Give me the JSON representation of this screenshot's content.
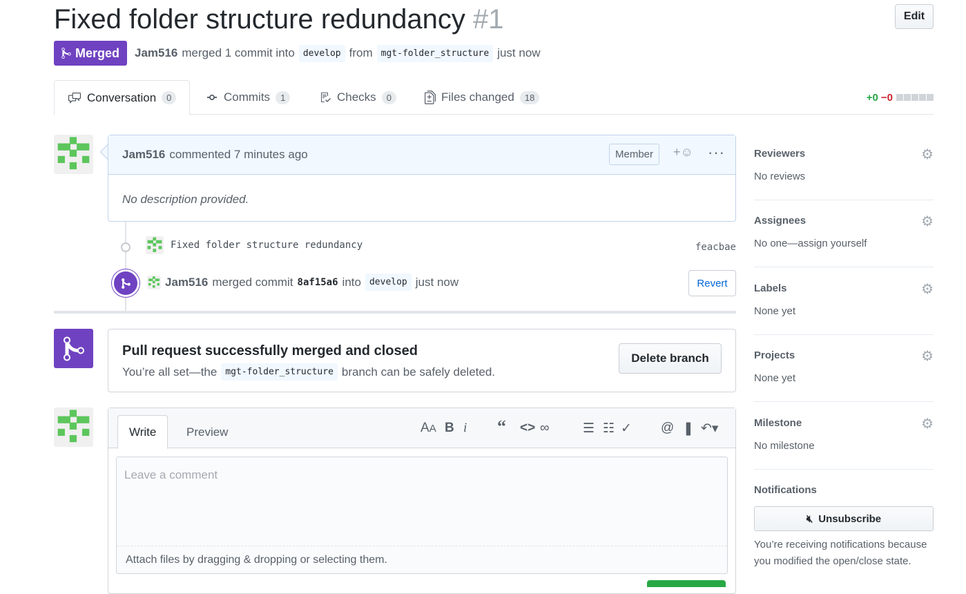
{
  "pr": {
    "title": "Fixed folder structure redundancy",
    "number": "#1",
    "edit_label": "Edit",
    "state": "Merged",
    "author": "Jam516",
    "merged_text": "merged 1 commit into",
    "base_branch": "develop",
    "from_text": "from",
    "head_branch": "mgt-folder_structure",
    "time": "just now"
  },
  "tabs": [
    {
      "label": "Conversation",
      "count": "0"
    },
    {
      "label": "Commits",
      "count": "1"
    },
    {
      "label": "Checks",
      "count": "0"
    },
    {
      "label": "Files changed",
      "count": "18"
    }
  ],
  "diffstat": {
    "additions": "+0",
    "deletions": "−0"
  },
  "comment": {
    "author": "Jam516",
    "action": "commented 7 minutes ago",
    "role": "Member",
    "react": "+☺",
    "more": "···",
    "body": "No description provided."
  },
  "commit": {
    "message": "Fixed folder structure redundancy",
    "sha": "feacbae"
  },
  "merge_event": {
    "author": "Jam516",
    "text": "merged commit",
    "sha": "8af15a6",
    "into": "into",
    "branch": "develop",
    "time": "just now",
    "revert_label": "Revert"
  },
  "merged_box": {
    "title": "Pull request successfully merged and closed",
    "sub_before": "You’re all set—the",
    "branch": "mgt-folder_structure",
    "sub_after": "branch can be safely deleted.",
    "delete_label": "Delete branch"
  },
  "new_comment": {
    "write_tab": "Write",
    "preview_tab": "Preview",
    "placeholder": "Leave a comment",
    "attach_text": "Attach files by dragging & dropping or selecting them."
  },
  "sidebar": {
    "reviewers": {
      "title": "Reviewers",
      "value": "No reviews"
    },
    "assignees": {
      "title": "Assignees",
      "value": "No one—assign yourself"
    },
    "labels": {
      "title": "Labels",
      "value": "None yet"
    },
    "projects": {
      "title": "Projects",
      "value": "None yet"
    },
    "milestone": {
      "title": "Milestone",
      "value": "No milestone"
    },
    "notifications": {
      "title": "Notifications",
      "button": "Unsubscribe",
      "text": "You’re receiving notifications because you modified the open/close state."
    }
  },
  "colors": {
    "merged": "#6f42c1",
    "link": "#0366d6",
    "add": "#28a745",
    "del": "#cb2431"
  },
  "icons": [
    "git-merge-icon",
    "comment-icon",
    "commit-icon",
    "checks-icon",
    "file-diff-icon",
    "gear-icon",
    "smiley-icon",
    "kebab-icon",
    "mute-icon",
    "text-size-icon",
    "bold-icon",
    "italic-icon",
    "quote-icon",
    "code-icon",
    "link-icon",
    "unordered-list-icon",
    "ordered-list-icon",
    "task-list-icon",
    "mention-icon",
    "bookmark-icon",
    "reply-icon"
  ]
}
